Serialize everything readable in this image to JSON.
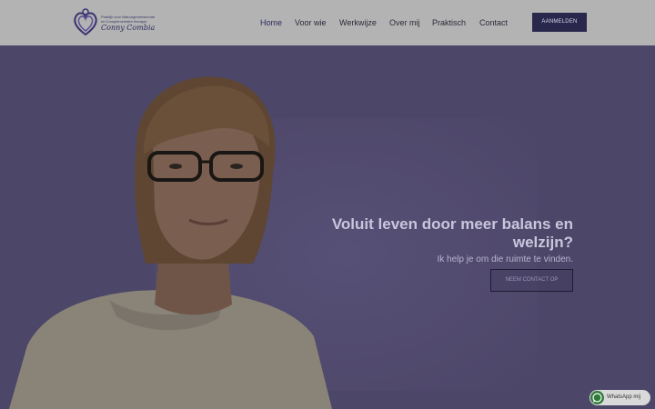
{
  "header": {
    "logo": {
      "tagline_line1": "Praktijk voor Natuurgeneeskunde",
      "tagline_line2": "en Complementaire therapie",
      "brand": "Conny Combia"
    },
    "nav": {
      "items": [
        {
          "label": "Home",
          "active": true
        },
        {
          "label": "Voor wie"
        },
        {
          "label": "Werkwijze"
        },
        {
          "label": "Over mij"
        },
        {
          "label": "Praktisch"
        },
        {
          "label": "Contact"
        }
      ]
    },
    "cta_label": "AANMELDEN"
  },
  "hero": {
    "headline": "Voluit leven door meer balans en welzijn?",
    "subline": "Ik help je om die ruimte te vinden.",
    "cta_label": "NEEM CONTACT OP"
  },
  "whatsapp": {
    "label": "WhatsApp mij",
    "icon": "whatsapp-icon"
  },
  "colors": {
    "header_bg": "#b3b3b3",
    "hero_bg": "#4c4668",
    "button_bg": "#2a274d",
    "whatsapp_green": "#2f7a3a"
  }
}
